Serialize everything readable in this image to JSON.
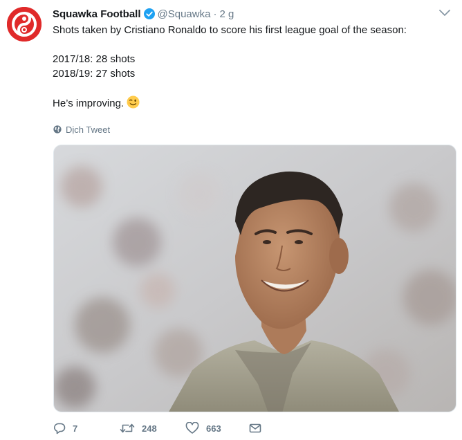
{
  "tweet": {
    "author_name": "Squawka Football",
    "handle": "@Squawka",
    "separator": "·",
    "time": "2 g",
    "lines": [
      "Shots taken by Cristiano Ronaldo to score his first league goal of the season:",
      "2017/18: 28 shots",
      "2018/19: 27 shots",
      "He’s improving."
    ],
    "translate_label": "Dịch Tweet",
    "stats": {
      "replies": "7",
      "retweets": "248",
      "likes": "663"
    }
  },
  "icons": {
    "avatar": "squawka-logo",
    "verified": "verified-badge-icon",
    "caret": "chevron-down-icon",
    "globe": "globe-icon",
    "emoji": "winking-face-icon",
    "reply": "reply-icon",
    "retweet": "retweet-icon",
    "like": "heart-icon",
    "dm": "envelope-icon"
  },
  "colors": {
    "brand_red": "#e02a2a",
    "verified_blue": "#1da1f2",
    "text": "#14171a",
    "muted": "#657786"
  }
}
